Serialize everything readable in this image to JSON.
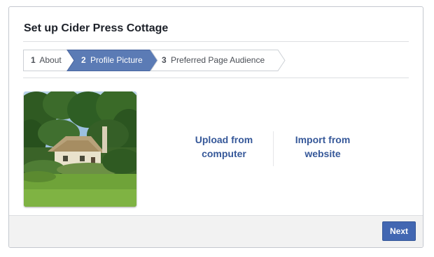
{
  "dialog": {
    "title": "Set up Cider Press Cottage"
  },
  "steps": [
    {
      "number": "1",
      "label": "About",
      "active": false
    },
    {
      "number": "2",
      "label": "Profile Picture",
      "active": true
    },
    {
      "number": "3",
      "label": "Preferred Page Audience",
      "active": false
    }
  ],
  "photo": {
    "description_icon": "cottage-photo"
  },
  "options": {
    "upload_line1": "Upload from",
    "upload_line2": "computer",
    "import_line1": "Import from",
    "import_line2": "website"
  },
  "footer": {
    "next_label": "Next"
  },
  "colors": {
    "accent": "#4267b2",
    "link": "#365899",
    "active_step": "#5b7bb5"
  }
}
